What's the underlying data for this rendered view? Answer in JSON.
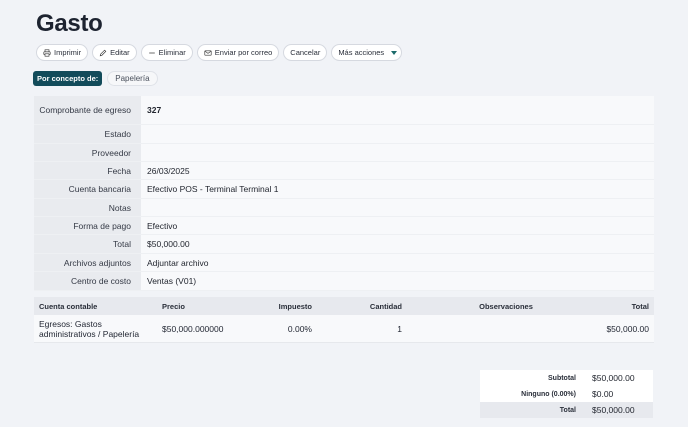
{
  "page": {
    "title": "Gasto"
  },
  "toolbar": {
    "print": "Imprimir",
    "edit": "Editar",
    "delete": "Eliminar",
    "email": "Enviar por correo",
    "cancel": "Cancelar",
    "more": "Más acciones"
  },
  "concept": {
    "label": "Por concepto de:",
    "value": "Papelería"
  },
  "details": {
    "comprobante_label": "Comprobante de egreso",
    "comprobante_value": "327",
    "estado_label": "Estado",
    "estado_value": "",
    "proveedor_label": "Proveedor",
    "proveedor_value": "",
    "fecha_label": "Fecha",
    "fecha_value": "26/03/2025",
    "cuenta_label": "Cuenta bancaria",
    "cuenta_value": "Efectivo POS - Terminal Terminal 1",
    "notas_label": "Notas",
    "notas_value": "",
    "forma_label": "Forma de pago",
    "forma_value": "Efectivo",
    "total_label": "Total",
    "total_value": "$50,000.00",
    "archivos_label": "Archivos adjuntos",
    "archivos_value": "Adjuntar archivo",
    "centro_label": "Centro de costo",
    "centro_value": "Ventas (V01)"
  },
  "items": {
    "headers": [
      "Cuenta contable",
      "Precio",
      "Impuesto",
      "Cantidad",
      "Observaciones",
      "Total"
    ],
    "rows": [
      [
        "Egresos: Gastos administrativos / Papelería",
        "$50,000.000000",
        "0.00%",
        "1",
        "",
        "$50,000.00"
      ]
    ]
  },
  "totals": {
    "subtotal_label": "Subtotal",
    "subtotal_value": "$50,000.00",
    "tax_label": "Ninguno (0.00%)",
    "tax_value": "$0.00",
    "total_label": "Total",
    "total_value": "$50,000.00"
  },
  "colors": {
    "accent": "#124b5a",
    "caret": "#1b6a6a",
    "background": "#f1f3f7"
  }
}
